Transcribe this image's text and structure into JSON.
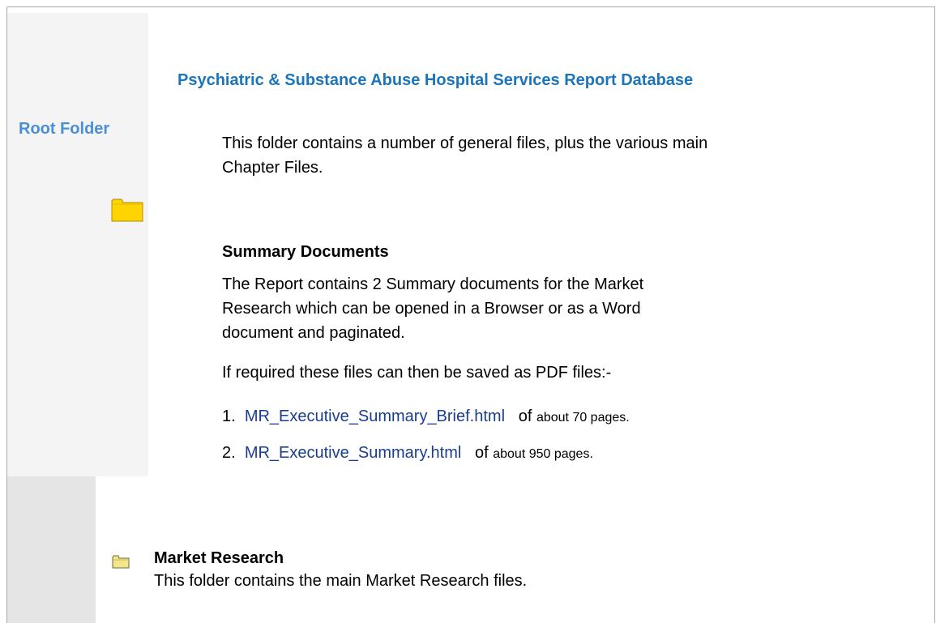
{
  "header": {
    "title": "Psychiatric & Substance Abuse Hospital Services Report Database"
  },
  "sidebar": {
    "root_label": "Root Folder"
  },
  "intro": {
    "text": "This folder contains a number of general files, plus the various main Chapter Files."
  },
  "summary": {
    "heading": "Summary Documents",
    "text": "The Report contains 2 Summary documents for the Market Research which can be opened in a Browser or as a Word document and paginated.",
    "pdf_note": "If required these files can then be saved as PDF files:-",
    "items": [
      {
        "number": "1.",
        "link": "MR_Executive_Summary_Brief.html",
        "of": "of",
        "desc": "about 70 pages."
      },
      {
        "number": "2.",
        "link": "MR_Executive_Summary.html",
        "of": "of",
        "desc": "about 950 pages."
      }
    ]
  },
  "market_research": {
    "heading": "Market Research",
    "text": "This folder contains the main Market Research files."
  },
  "icons": {
    "root_folder": "folder-icon",
    "market_research_folder": "folder-icon"
  },
  "colors": {
    "title": "#1b75bb",
    "root_label": "#4a8fd6",
    "link": "#1a3d8f",
    "folder_yellow": "#ffd400"
  }
}
